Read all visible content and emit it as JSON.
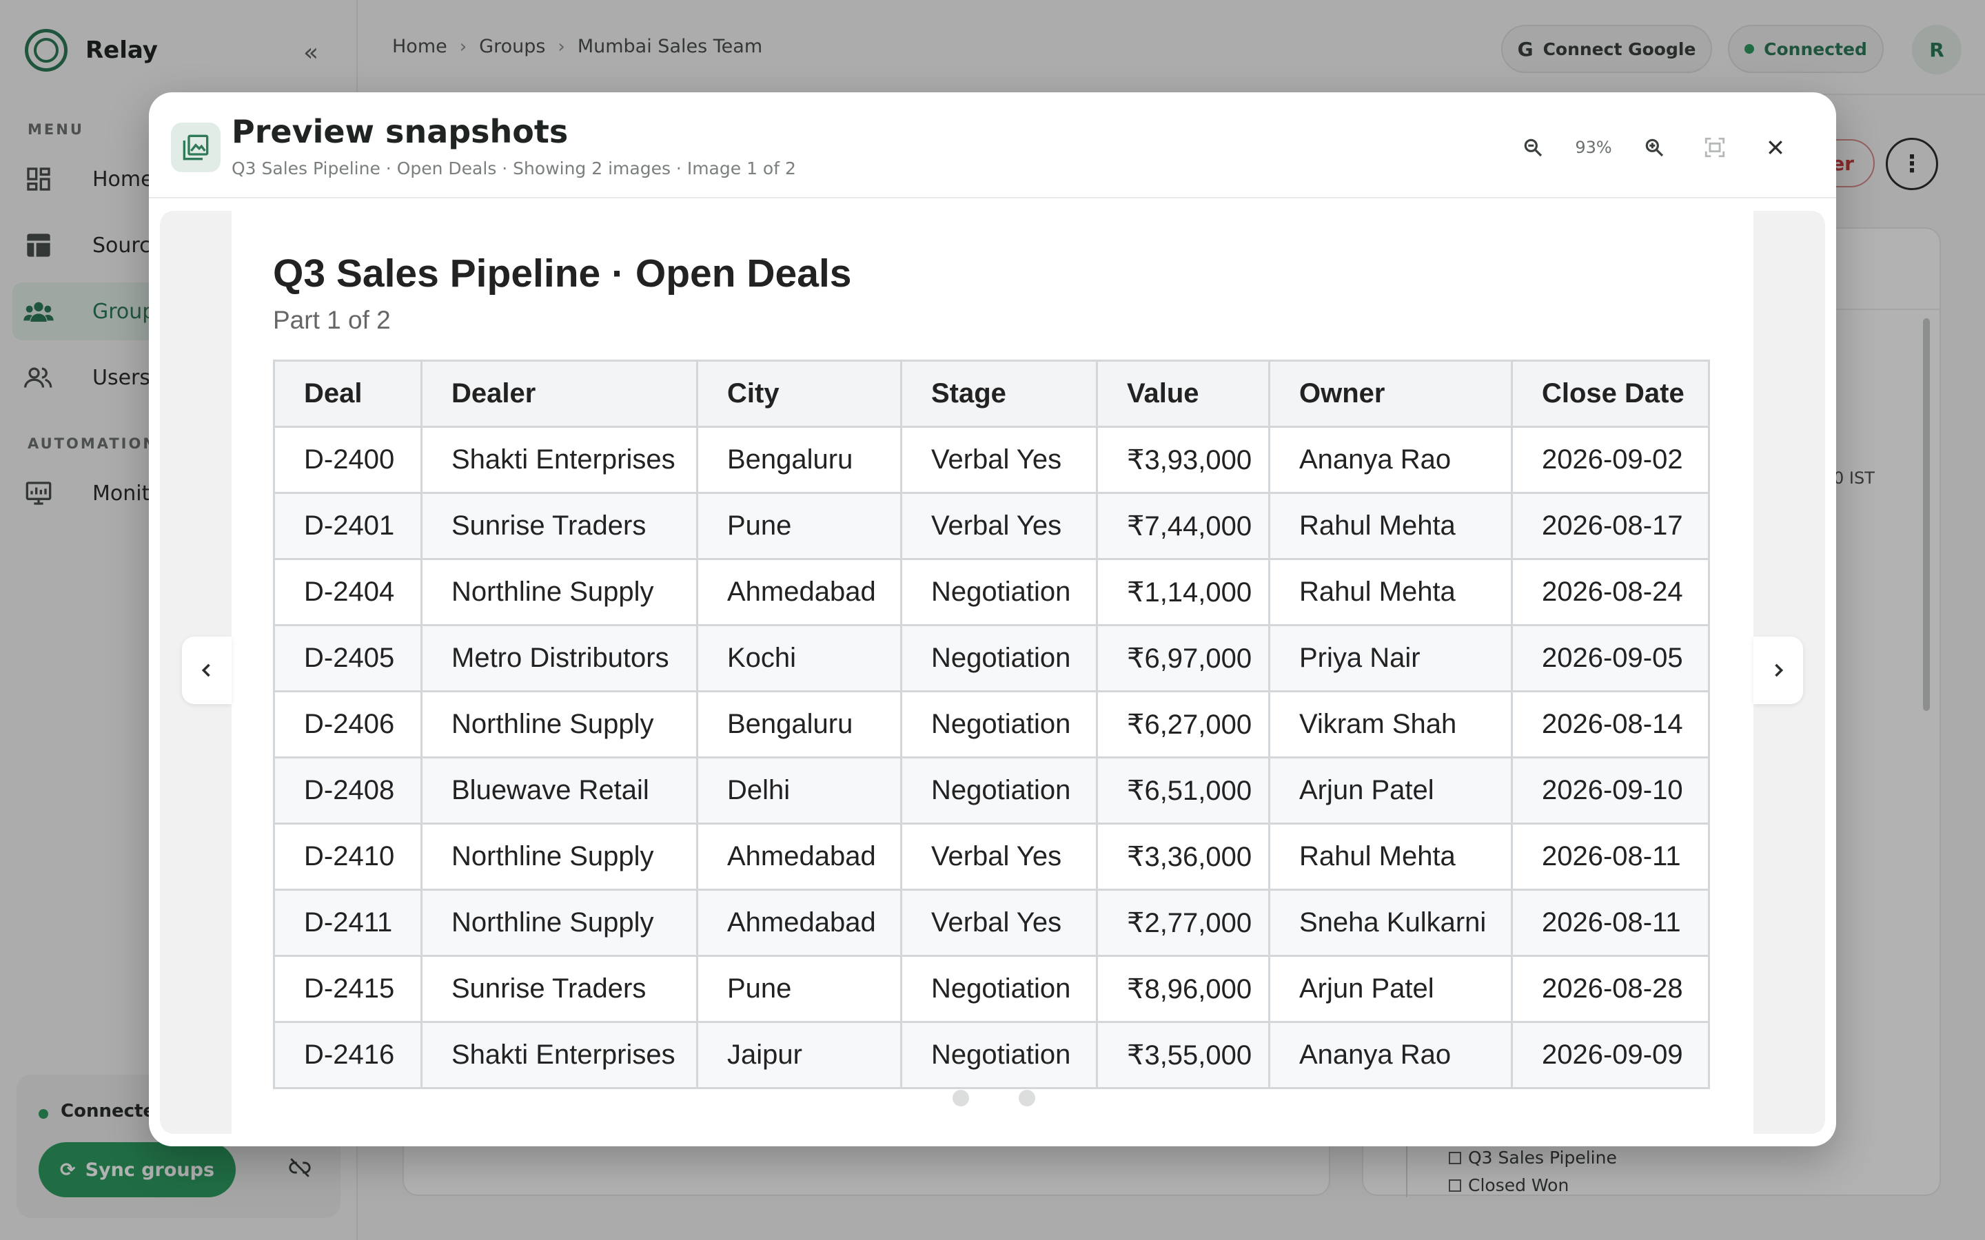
{
  "app": {
    "name": "Relay"
  },
  "sidebar": {
    "menu_label": "MENU",
    "automation_label": "AUTOMATION",
    "items": [
      {
        "label": "Home",
        "icon": "dashboard-icon"
      },
      {
        "label": "Sources",
        "icon": "table-icon"
      },
      {
        "label": "Groups",
        "icon": "groups-icon",
        "active": true
      },
      {
        "label": "Users",
        "icon": "users-icon"
      },
      {
        "label": "Monitor",
        "icon": "monitor-icon"
      }
    ],
    "status": {
      "text": "Connected",
      "sync_label": "Sync groups"
    }
  },
  "header": {
    "breadcrumb": [
      "Home",
      "Groups",
      "Mumbai Sales Team"
    ],
    "connect_google_label": "Connect Google",
    "connected_label": "Connected",
    "avatar_initial": "R"
  },
  "background": {
    "red_button_label": "er",
    "time_suffix": "0 IST",
    "sources": [
      "Q3 Sales Pipeline",
      "Closed Won"
    ]
  },
  "modal": {
    "title": "Preview snapshots",
    "subtitle": "Q3 Sales Pipeline · Open Deals · Showing 2 images · Image 1 of 2",
    "zoom_level": "93%",
    "image_count": 2,
    "current_image": 1
  },
  "snapshot": {
    "title": "Q3 Sales Pipeline · Open Deals",
    "part": "Part 1 of 2",
    "columns": [
      "Deal",
      "Dealer",
      "City",
      "Stage",
      "Value",
      "Owner",
      "Close Date"
    ],
    "rows": [
      [
        "D-2400",
        "Shakti Enterprises",
        "Bengaluru",
        "Verbal Yes",
        "₹3,93,000",
        "Ananya Rao",
        "2026-09-02"
      ],
      [
        "D-2401",
        "Sunrise Traders",
        "Pune",
        "Verbal Yes",
        "₹7,44,000",
        "Rahul Mehta",
        "2026-08-17"
      ],
      [
        "D-2404",
        "Northline Supply",
        "Ahmedabad",
        "Negotiation",
        "₹1,14,000",
        "Rahul Mehta",
        "2026-08-24"
      ],
      [
        "D-2405",
        "Metro Distributors",
        "Kochi",
        "Negotiation",
        "₹6,97,000",
        "Priya Nair",
        "2026-09-05"
      ],
      [
        "D-2406",
        "Northline Supply",
        "Bengaluru",
        "Negotiation",
        "₹6,27,000",
        "Vikram Shah",
        "2026-08-14"
      ],
      [
        "D-2408",
        "Bluewave Retail",
        "Delhi",
        "Negotiation",
        "₹6,51,000",
        "Arjun Patel",
        "2026-09-10"
      ],
      [
        "D-2410",
        "Northline Supply",
        "Ahmedabad",
        "Verbal Yes",
        "₹3,36,000",
        "Rahul Mehta",
        "2026-08-11"
      ],
      [
        "D-2411",
        "Northline Supply",
        "Ahmedabad",
        "Verbal Yes",
        "₹2,77,000",
        "Sneha Kulkarni",
        "2026-08-11"
      ],
      [
        "D-2415",
        "Sunrise Traders",
        "Pune",
        "Negotiation",
        "₹8,96,000",
        "Arjun Patel",
        "2026-08-28"
      ],
      [
        "D-2416",
        "Shakti Enterprises",
        "Jaipur",
        "Negotiation",
        "₹3,55,000",
        "Ananya Rao",
        "2026-09-09"
      ]
    ]
  },
  "colors": {
    "accent": "#2f7a58",
    "success": "#2f9c62",
    "danger": "#c53b3b"
  }
}
